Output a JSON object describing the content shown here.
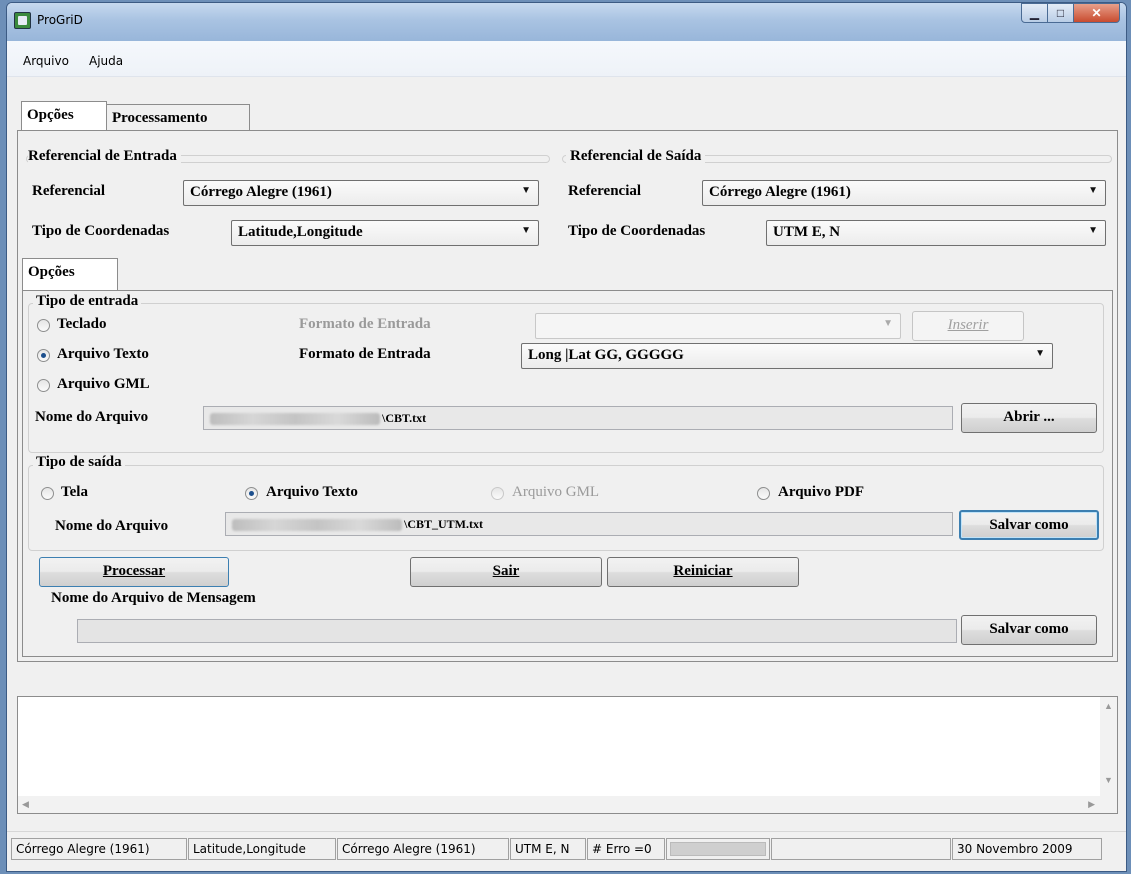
{
  "window": {
    "title": "ProGriD"
  },
  "menu": {
    "items": [
      "Arquivo",
      "Ajuda"
    ]
  },
  "tabs": {
    "main": [
      "Opções",
      "Processamento"
    ],
    "inner": "Opções"
  },
  "entrada": {
    "title": "Referencial de Entrada",
    "referencial_label": "Referencial",
    "referencial_value": "Córrego Alegre (1961)",
    "tipo_label": "Tipo de Coordenadas",
    "tipo_value": "Latitude,Longitude"
  },
  "saida": {
    "title": "Referencial de Saída",
    "referencial_label": "Referencial",
    "referencial_value": "Córrego Alegre (1961)",
    "tipo_label": "Tipo de Coordenadas",
    "tipo_value": "UTM E, N"
  },
  "tipo_entrada": {
    "title": "Tipo de entrada",
    "options": [
      "Teclado",
      "Arquivo Texto",
      "Arquivo GML"
    ],
    "selected": "Arquivo Texto",
    "formato_label": "Formato de Entrada",
    "formato_value": "Long |Lat GG, GGGGG",
    "inserir_label": "Inserir",
    "arquivo_label": "Nome do Arquivo",
    "arquivo_value": "\\CBT.txt",
    "abrir_label": "Abrir ..."
  },
  "tipo_saida": {
    "title": "Tipo de saída",
    "options": [
      "Tela",
      "Arquivo Texto",
      "Arquivo GML",
      "Arquivo PDF"
    ],
    "selected": "Arquivo Texto",
    "arquivo_label": "Nome do Arquivo",
    "arquivo_value": "\\CBT_UTM.txt",
    "salvar_label": "Salvar como"
  },
  "actions": {
    "processar": "Processar",
    "sair": "Sair",
    "reiniciar": "Reiniciar"
  },
  "mensagem": {
    "label": "Nome do Arquivo de Mensagem",
    "value": "",
    "salvar_label": "Salvar como"
  },
  "statusbar": {
    "ref_in": "Córrego Alegre (1961)",
    "coord_in": "Latitude,Longitude",
    "ref_out": "Córrego Alegre (1961)",
    "coord_out": "UTM E, N",
    "errors": "# Erro =0",
    "progress": 0,
    "date": "30 Novembro 2009"
  },
  "colors": {
    "focus": "#3c7fb1",
    "radio_dot": "#1c4f8d",
    "titlebar": "#a9c3e2"
  }
}
